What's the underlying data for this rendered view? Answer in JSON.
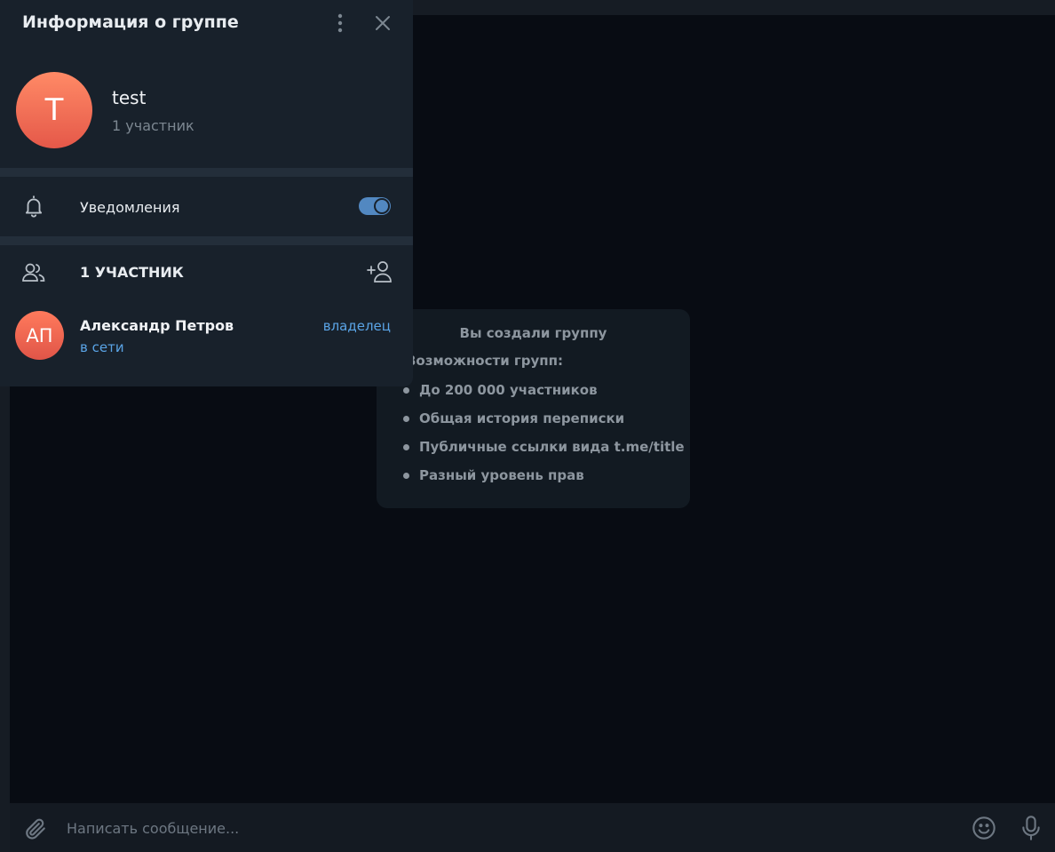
{
  "panel": {
    "title": "Информация о группе",
    "group": {
      "avatar_letter": "T",
      "name": "test",
      "members_count": "1 участник"
    },
    "notifications": {
      "label": "Уведомления",
      "enabled": true
    },
    "members_header": "1 УЧАСТНИК",
    "members": [
      {
        "initials": "АП",
        "name": "Александр Петров",
        "status": "в сети",
        "role": "владелец"
      }
    ]
  },
  "service_message": {
    "title": "Вы создали группу",
    "subtitle": "Возможности групп:",
    "items": [
      "До 200 000 участников",
      "Общая история переписки",
      "Публичные ссылки вида t.me/title",
      "Разный уровень прав"
    ]
  },
  "composer": {
    "placeholder": "Написать сообщение..."
  },
  "colors": {
    "accent": "#5288c1",
    "link": "#5aa4e6",
    "avatar": "#f0705a"
  },
  "icons": [
    "more-vertical-icon",
    "close-icon",
    "bell-icon",
    "people-icon",
    "add-member-icon",
    "paperclip-icon",
    "emoji-icon",
    "mic-icon"
  ]
}
